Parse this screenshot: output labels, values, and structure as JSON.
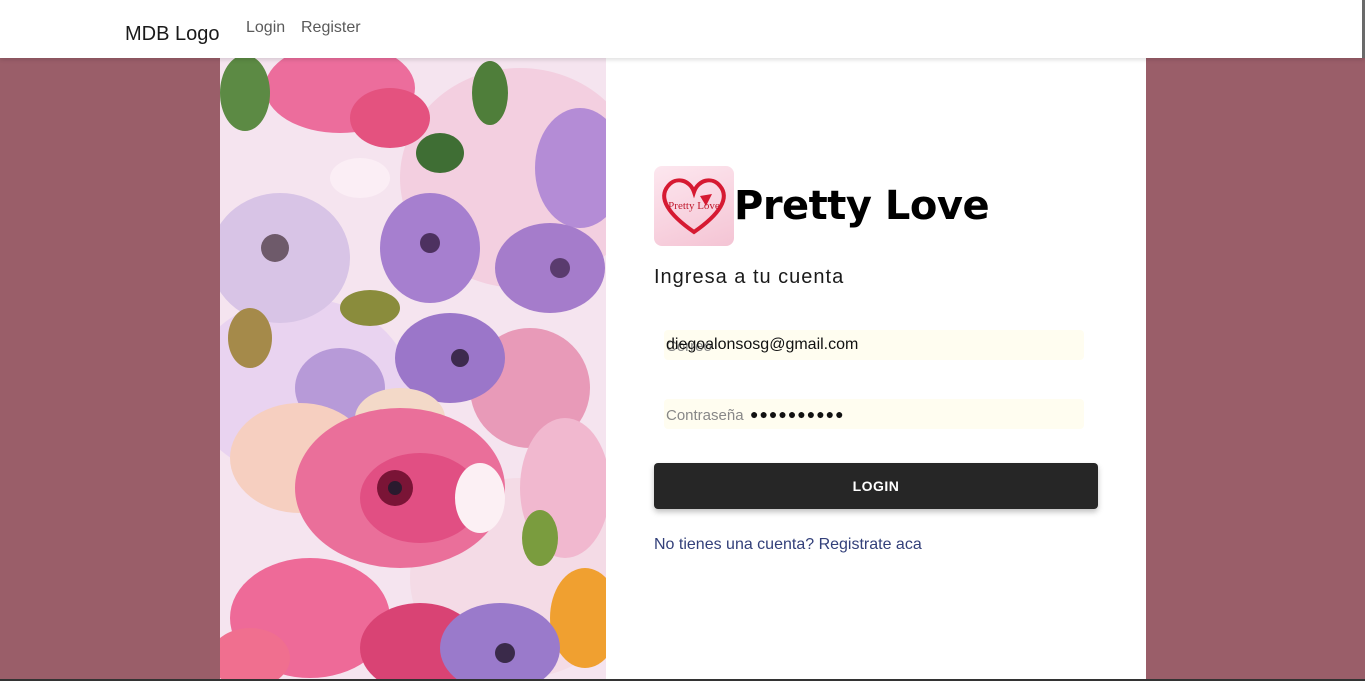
{
  "navbar": {
    "brand": "MDB Logo",
    "links": [
      "Login",
      "Register"
    ]
  },
  "login_card": {
    "logo": {
      "icon": "heart-logo-icon",
      "text": "Pretty Love"
    },
    "title": "Pretty Love",
    "subtitle": "Ingresa a tu cuenta",
    "email": {
      "label": "Correo",
      "value": "diegoalonsosg@gmail.com"
    },
    "password": {
      "label": "Contraseña",
      "value": "●●●●●●●●●●"
    },
    "login_button": "LOGIN",
    "register_link": "No tienes una cuenta? Registrate aca"
  },
  "colors": {
    "page_background": "#9a5e69",
    "button": "#262626",
    "link": "#33407a",
    "input_autofill": "#fffdf0"
  }
}
